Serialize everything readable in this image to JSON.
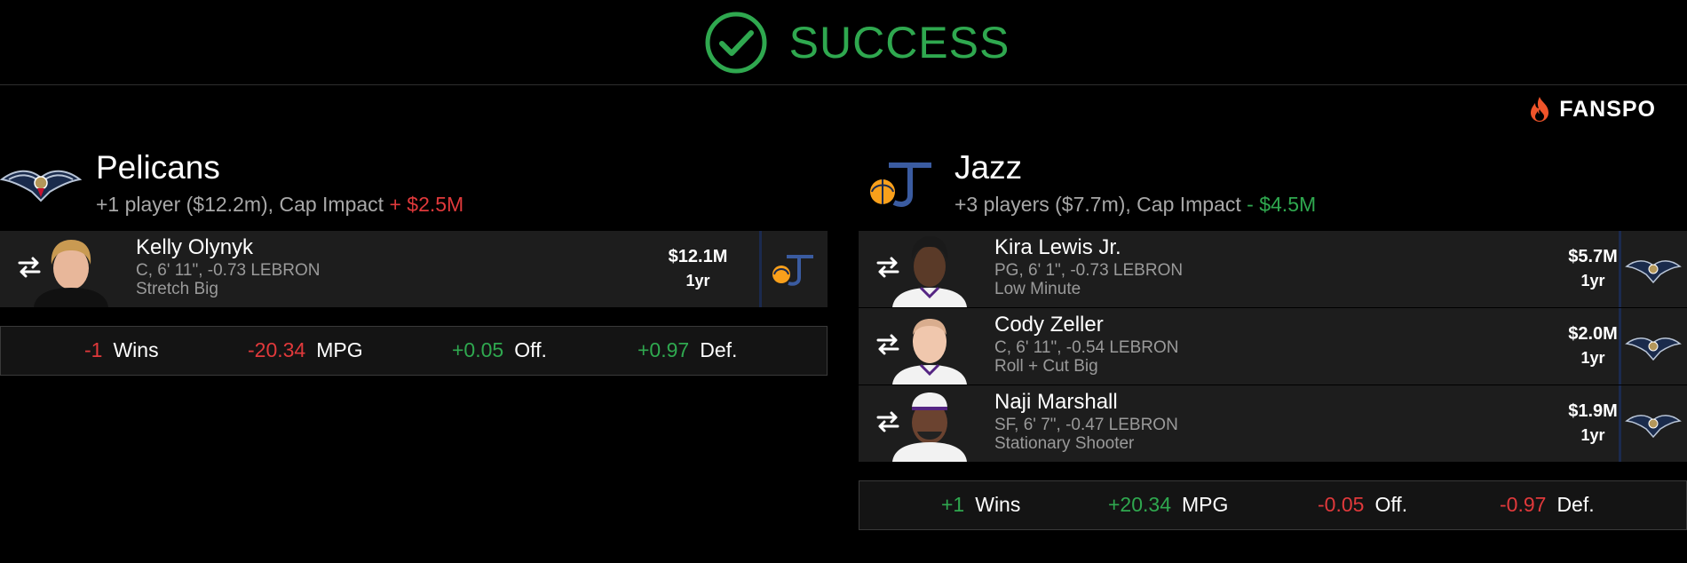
{
  "banner": {
    "status": "SUCCESS"
  },
  "brand": {
    "name": "FANSPO"
  },
  "colors": {
    "success": "#2fa84f",
    "negative": "#e0393b",
    "positive": "#2fa84f",
    "card_bg": "#1d1d1d"
  },
  "teams": [
    {
      "name": "Pelicans",
      "summary_prefix": "+1 player ($12.2m), Cap Impact",
      "cap_impact": "+ $2.5M",
      "cap_impact_color": "negative",
      "logo": "pelicans-logo",
      "players": [
        {
          "name": "Kelly Olynyk",
          "line1": "C, 6' 11\", -0.73 LEBRON",
          "line2": "Stretch Big",
          "salary": "$12.1M",
          "years": "1yr",
          "destination_logo": "jazz-logo"
        }
      ],
      "stats": [
        {
          "value": "-1",
          "label": "Wins",
          "tone": "negative"
        },
        {
          "value": "-20.34",
          "label": "MPG",
          "tone": "negative"
        },
        {
          "value": "+0.05",
          "label": "Off.",
          "tone": "positive"
        },
        {
          "value": "+0.97",
          "label": "Def.",
          "tone": "positive"
        }
      ]
    },
    {
      "name": "Jazz",
      "summary_prefix": "+3 players ($7.7m), Cap Impact",
      "cap_impact": "- $4.5M",
      "cap_impact_color": "positive",
      "logo": "jazz-logo",
      "players": [
        {
          "name": "Kira Lewis Jr.",
          "line1": "PG, 6' 1\", -0.73 LEBRON",
          "line2": "Low Minute",
          "salary": "$5.7M",
          "years": "1yr",
          "destination_logo": "pelicans-logo"
        },
        {
          "name": "Cody Zeller",
          "line1": "C, 6' 11\", -0.54 LEBRON",
          "line2": "Roll + Cut Big",
          "salary": "$2.0M",
          "years": "1yr",
          "destination_logo": "pelicans-logo"
        },
        {
          "name": "Naji Marshall",
          "line1": "SF, 6' 7\", -0.47 LEBRON",
          "line2": "Stationary Shooter",
          "salary": "$1.9M",
          "years": "1yr",
          "destination_logo": "pelicans-logo"
        }
      ],
      "stats": [
        {
          "value": "+1",
          "label": "Wins",
          "tone": "positive"
        },
        {
          "value": "+20.34",
          "label": "MPG",
          "tone": "positive"
        },
        {
          "value": "-0.05",
          "label": "Off.",
          "tone": "negative"
        },
        {
          "value": "-0.97",
          "label": "Def.",
          "tone": "negative"
        }
      ]
    }
  ]
}
